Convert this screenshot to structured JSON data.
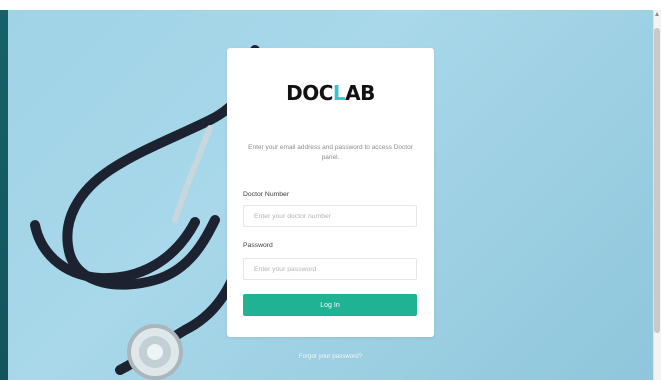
{
  "brand": {
    "logo_part_1": "DOC",
    "logo_part_2": "L",
    "logo_part_3": "AB"
  },
  "auth": {
    "subtitle": "Enter your email address and password to access Doctor panel.",
    "doctor_number_label": "Doctor Number",
    "doctor_number_placeholder": "Enter your doctor number",
    "password_label": "Password",
    "password_placeholder": "Enter your password",
    "login_button_label": "Log In",
    "forgot_password_link": "Forgot your password?"
  },
  "theme": {
    "accent": "#1fb394",
    "logo_accent": "#39c5cf",
    "background": "#a8d8ea"
  },
  "icons": {
    "scroll_up": "chevron-up-icon"
  }
}
